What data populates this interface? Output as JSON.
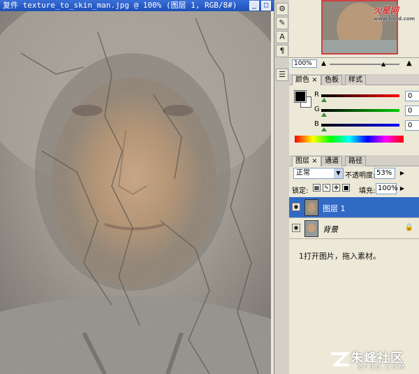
{
  "document": {
    "title": "复件 texture_to_skin_man.jpg @ 100% (图层 1, RGB/8#)"
  },
  "navigator": {
    "zoom": "100%"
  },
  "color_panel": {
    "tabs": [
      "颜色",
      "色板",
      "样式"
    ],
    "r_label": "R",
    "g_label": "G",
    "b_label": "B",
    "r_value": "0",
    "g_value": "0",
    "b_value": "0",
    "foreground": "#000000",
    "background": "#ffffff"
  },
  "layers_panel": {
    "tabs": [
      "图层",
      "通道",
      "路径"
    ],
    "blend_mode": "正常",
    "opacity_label": "不透明度:",
    "opacity_value": "53%",
    "lock_label": "锁定:",
    "fill_label": "填充:",
    "fill_value": "100%",
    "layers": [
      {
        "name": "图层 1",
        "selected": true
      },
      {
        "name": "背景",
        "selected": false,
        "locked": true
      }
    ],
    "note": "1打开图片，拖入素材。"
  },
  "watermarks": {
    "top_logo": "火星网",
    "top_logo_url": "www.hxsd.com",
    "bottom_logo_cn": "朱峰社区",
    "bottom_logo_en": "ZF3D.COM"
  },
  "icons": {
    "close": "close-icon",
    "minimize": "minimize-icon",
    "maximize": "maximize-icon",
    "eye": "eye-icon",
    "lock": "lock-icon"
  }
}
